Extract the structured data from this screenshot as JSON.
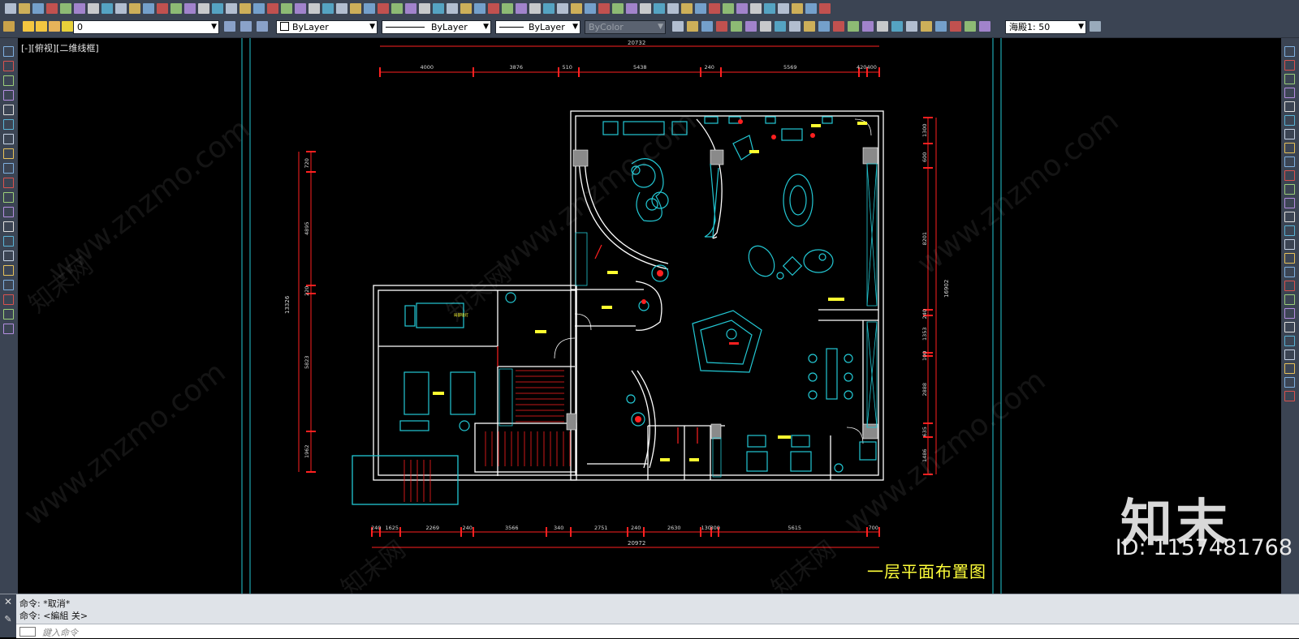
{
  "toolbar_row2": {
    "layer_value": "0",
    "color_value": "ByLayer",
    "linetype_value": "ByLayer",
    "lineweight_value": "ByLayer",
    "plotstyle_value": "ByColor",
    "annotation_scale": "海殿1: 50"
  },
  "viewport": {
    "label": "[-][俯视][二维线框]",
    "drawing_title": "一层平面布置图",
    "top_dims_total": "20732",
    "top_dims": [
      "4000",
      "3876",
      "510",
      "5438",
      "240",
      "5569",
      "420",
      "400"
    ],
    "bottom_dims": [
      "240",
      "1625",
      "2269",
      "240",
      "3566",
      "340",
      "2751",
      "240",
      "2630",
      "130",
      "300",
      "5615",
      "700"
    ],
    "bottom_dims_total": "20972",
    "left_dims": [
      "720",
      "4895",
      "220",
      "5823",
      "1962"
    ],
    "left_dims_total": "13326",
    "right_dims": [
      "1300",
      "600",
      "8201",
      "240",
      "1353",
      "100",
      "2888",
      "635",
      "1486"
    ],
    "right_dims_total": "16902",
    "bed_label": "局部墙灯"
  },
  "watermark": {
    "text": "www.znzmo.com",
    "cn": "知末网",
    "brand": "知末",
    "id": "ID: 1157481768"
  },
  "command": {
    "line1": "命令: *取消*",
    "line2": "命令:  <編組 关>",
    "input_placeholder": "鍵入命令"
  },
  "colors": {
    "wall": "#ffffff",
    "cyan": "#23c8d4",
    "red": "#ff2020",
    "yellow": "#ffff30",
    "ui_bg": "#3b4453"
  }
}
